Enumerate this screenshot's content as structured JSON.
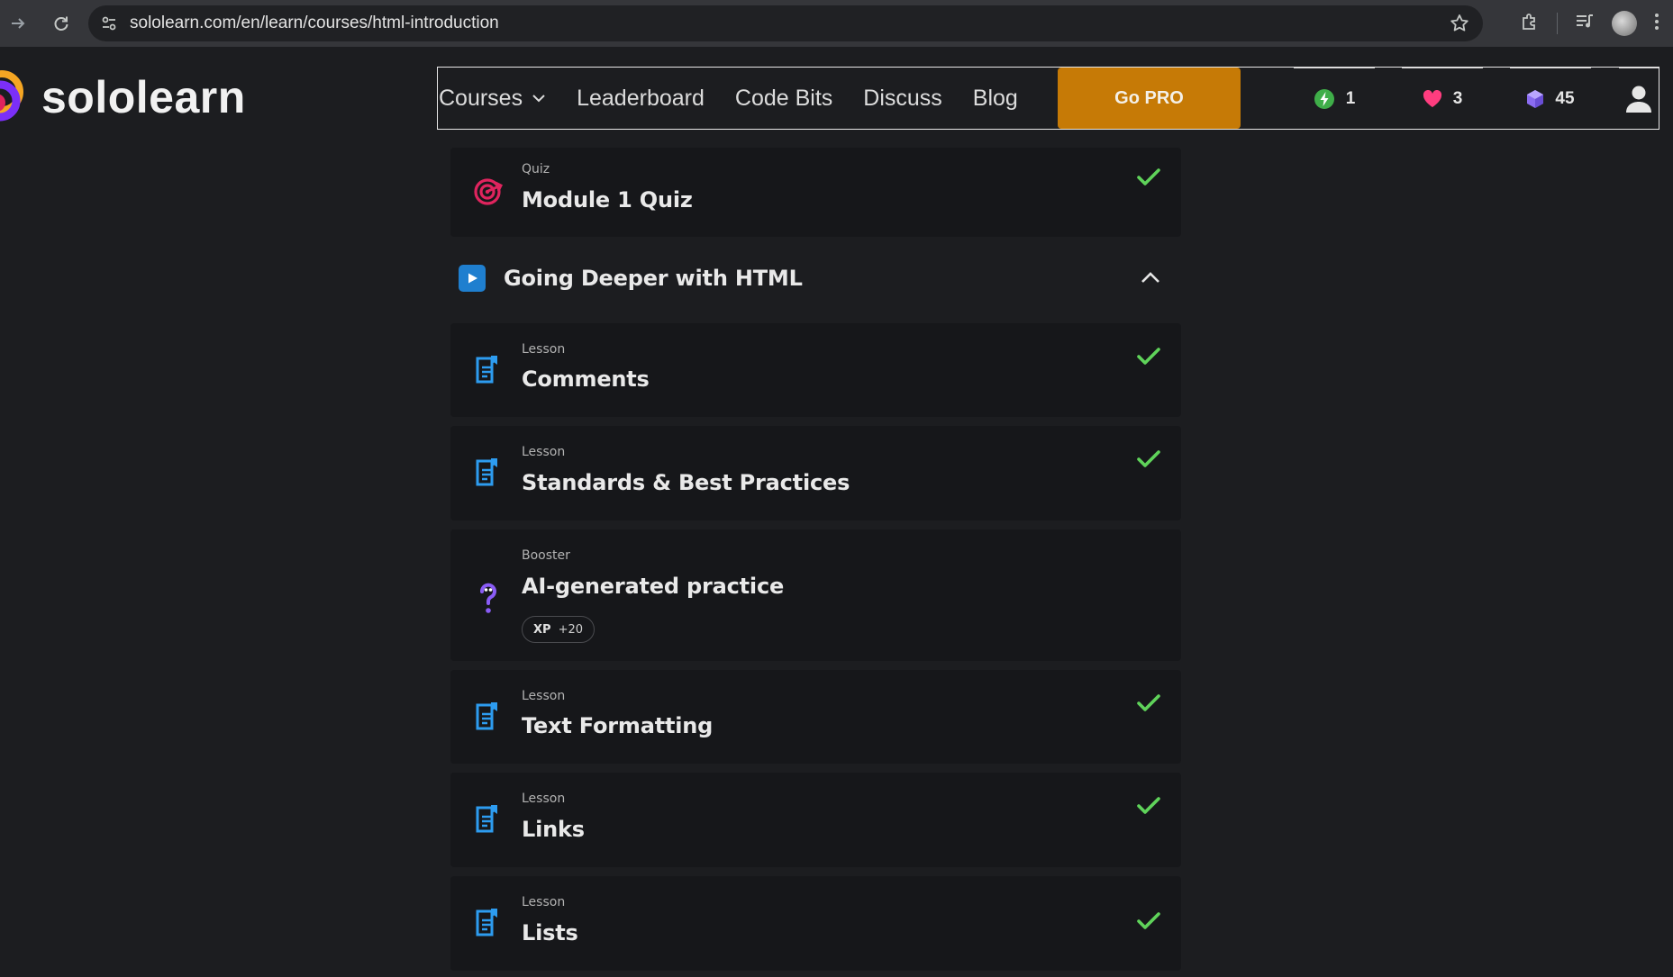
{
  "browser": {
    "url": "sololearn.com/en/learn/courses/html-introduction"
  },
  "header": {
    "logo_text": "sololearn",
    "nav": {
      "courses": "Courses",
      "leaderboard": "Leaderboard",
      "code_bits": "Code Bits",
      "discuss": "Discuss",
      "blog": "Blog"
    },
    "go_pro": "Go PRO",
    "stats": {
      "streak": "1",
      "hearts": "3",
      "gems": "45"
    }
  },
  "quiz_card": {
    "type": "Quiz",
    "title": "Module 1 Quiz",
    "completed": true
  },
  "section": {
    "title": "Going Deeper with HTML",
    "expanded": true
  },
  "items": [
    {
      "type": "Lesson",
      "title": "Comments",
      "completed": true
    },
    {
      "type": "Lesson",
      "title": "Standards & Best Practices",
      "completed": true
    },
    {
      "type": "Booster",
      "title": "AI-generated practice",
      "completed": false,
      "xp_label": "XP",
      "xp_value": "+20"
    },
    {
      "type": "Lesson",
      "title": "Text Formatting",
      "completed": true
    },
    {
      "type": "Lesson",
      "title": "Links",
      "completed": true
    },
    {
      "type": "Lesson",
      "title": "Lists",
      "completed": true
    }
  ],
  "colors": {
    "background": "#1c1d20",
    "card": "#16171a",
    "check": "#5fd35a",
    "lesson_icon": "#2d9cf0",
    "quiz_icon": "#e0245e",
    "booster_icon": "#8a5cf6",
    "go_pro": "#c67a06"
  },
  "icons": {
    "lesson": "document-icon",
    "quiz": "target-icon",
    "booster": "question-icon",
    "completed": "check-icon"
  }
}
